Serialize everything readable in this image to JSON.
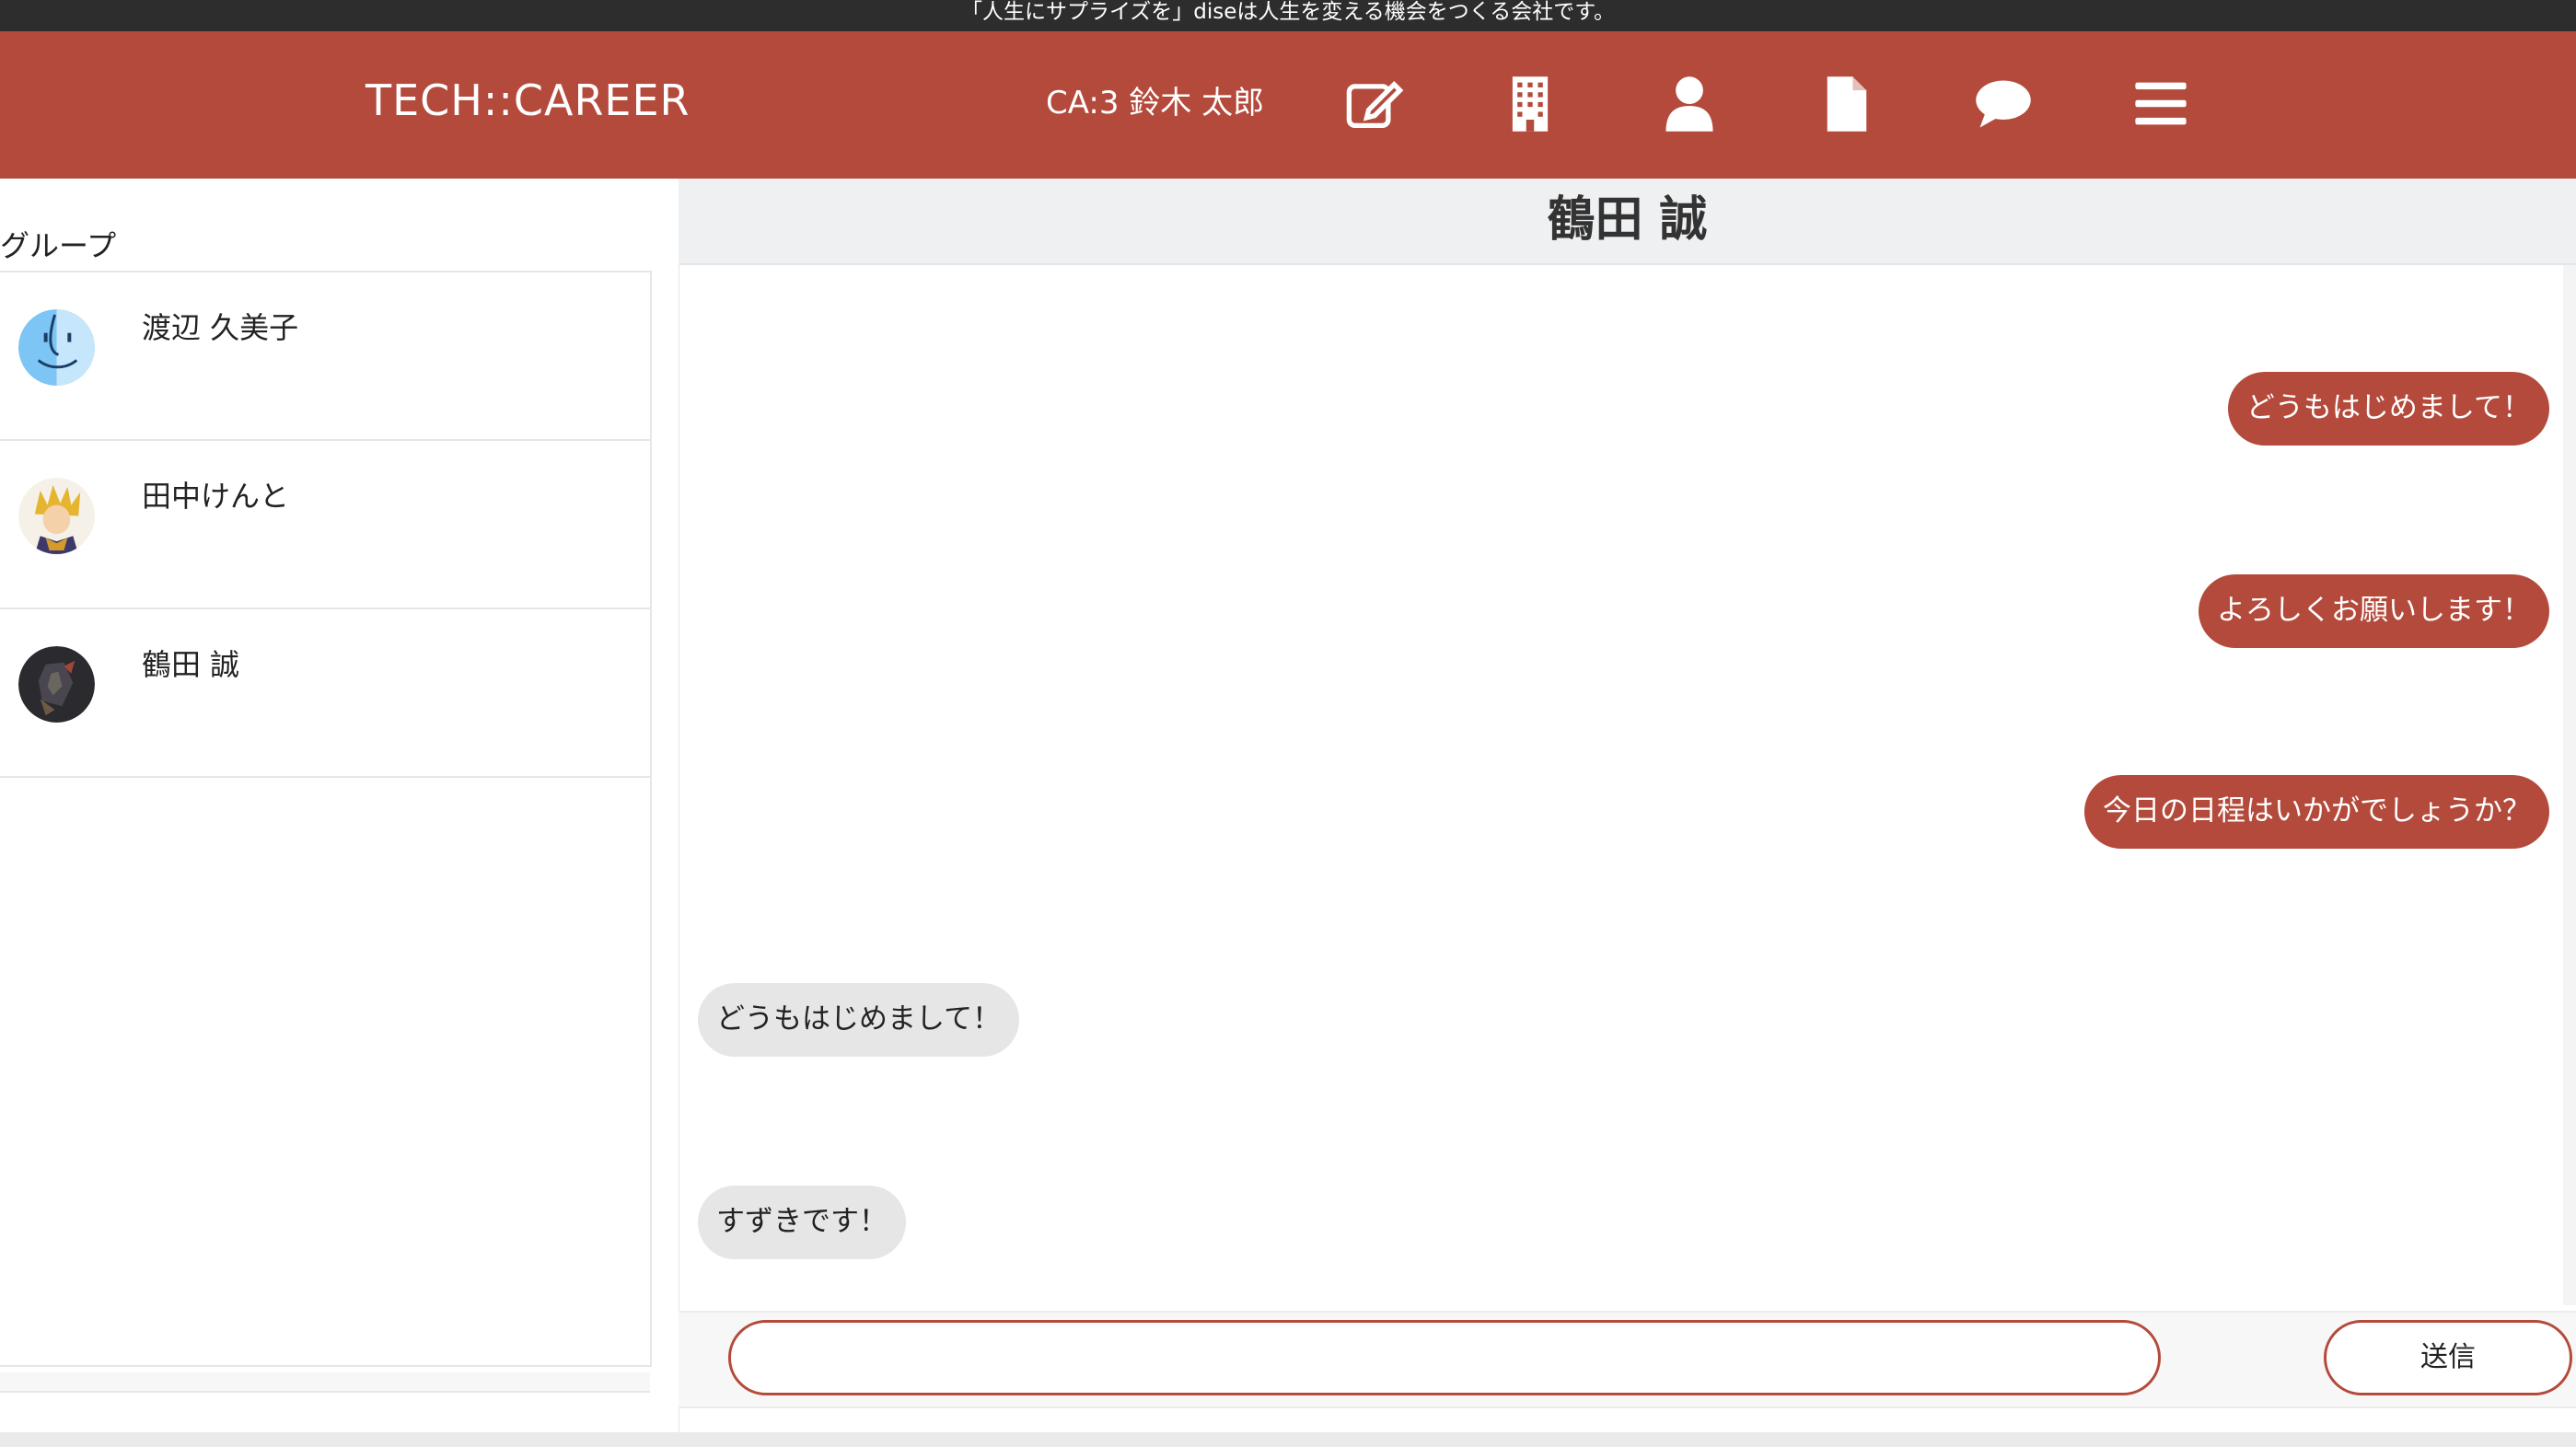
{
  "top_banner": "「人生にサプライズを」diseは人生を変える機会をつくる会社です。",
  "header": {
    "logo": "TECH::CAREER",
    "user": "CA:3 鈴木 太郎",
    "icons": [
      "edit-icon",
      "building-icon",
      "user-icon",
      "document-icon",
      "chat-icon",
      "menu-icon"
    ]
  },
  "sidebar": {
    "title": "グループ",
    "items": [
      {
        "name": "渡辺 久美子",
        "avatar": "finder-face-avatar"
      },
      {
        "name": "田中けんと",
        "avatar": "anime-character-avatar"
      },
      {
        "name": "鶴田 誠",
        "avatar": "dark-photo-avatar"
      }
    ]
  },
  "chat": {
    "title": "鶴田 誠",
    "messages": [
      {
        "side": "out",
        "text": "どうもはじめまして！"
      },
      {
        "side": "out",
        "text": "よろしくお願いします！"
      },
      {
        "side": "out",
        "text": "今日の日程はいかがでしょうか？"
      },
      {
        "side": "in",
        "text": "どうもはじめまして！"
      },
      {
        "side": "in",
        "text": "すずきです！"
      }
    ],
    "input_value": "",
    "send_label": "送信"
  },
  "colors": {
    "brand": "#b44a3b",
    "topbar": "#2d2d2d",
    "incoming_bubble": "#e6e6e6"
  }
}
